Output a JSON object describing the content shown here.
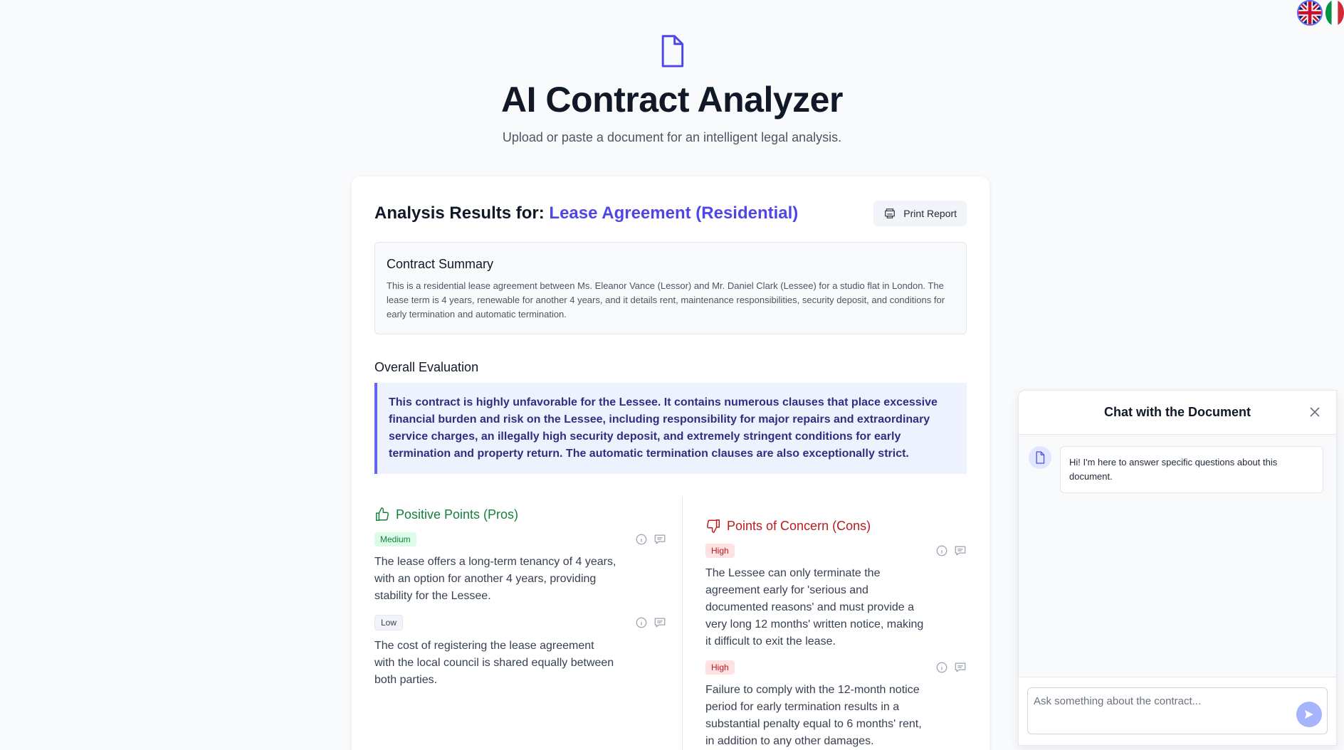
{
  "languages": [
    {
      "code": "en",
      "icon": "uk-flag-icon",
      "selected": true
    },
    {
      "code": "it",
      "icon": "italy-flag-icon",
      "selected": false
    }
  ],
  "header": {
    "icon": "document-icon",
    "title": "AI Contract Analyzer",
    "subtitle": "Upload or paste a document for an intelligent legal analysis."
  },
  "results": {
    "title_prefix": "Analysis Results for:",
    "document_name": "Lease Agreement (Residential)",
    "print_label": "Print Report",
    "summary": {
      "title": "Contract Summary",
      "text": "This is a residential lease agreement between Ms. Eleanor Vance (Lessor) and Mr. Daniel Clark (Lessee) for a studio flat in London. The lease term is 4 years, renewable for another 4 years, and it details rent, maintenance responsibilities, security deposit, and conditions for early termination and automatic termination."
    },
    "evaluation": {
      "title": "Overall Evaluation",
      "text": "This contract is highly unfavorable for the Lessee. It contains numerous clauses that place excessive financial burden and risk on the Lessee, including responsibility for major repairs and extraordinary service charges, an illegally high security deposit, and extremely stringent conditions for early termination and property return. The automatic termination clauses are also exceptionally strict."
    },
    "pros": {
      "title": "Positive Points (Pros)",
      "items": [
        {
          "severity": "Medium",
          "text": "The lease offers a long-term tenancy of 4 years, with an option for another 4 years, providing stability for the Lessee."
        },
        {
          "severity": "Low",
          "text": "The cost of registering the lease agreement with the local council is shared equally between both parties."
        }
      ]
    },
    "cons": {
      "title": "Points of Concern (Cons)",
      "items": [
        {
          "severity": "High",
          "text": "The Lessee can only terminate the agreement early for 'serious and documented reasons' and must provide a very long 12 months' written notice, making it difficult to exit the lease."
        },
        {
          "severity": "High",
          "text": "Failure to comply with the 12-month notice period for early termination results in a substantial penalty equal to 6 months' rent, in addition to any other damages."
        }
      ]
    }
  },
  "chat": {
    "title": "Chat with the Document",
    "greeting": "Hi! I'm here to answer specific questions about this document.",
    "input_placeholder": "Ask something about the contract..."
  },
  "colors": {
    "accent": "#4f46e5",
    "pros": "#15803d",
    "cons": "#b91c1c",
    "evaluation_bg": "#eef2ff"
  }
}
